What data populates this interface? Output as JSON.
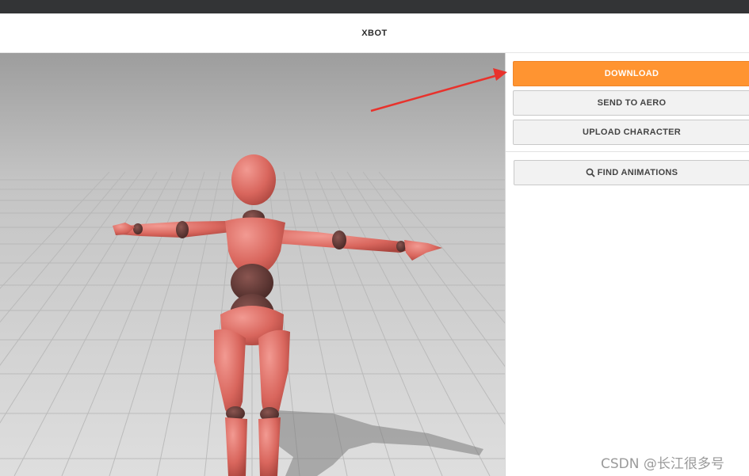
{
  "header": {
    "title": "XBOT"
  },
  "panel": {
    "download_label": "DOWNLOAD",
    "send_label": "SEND TO AERO",
    "upload_label": "UPLOAD CHARACTER",
    "find_label": "FIND ANIMATIONS"
  },
  "viewport": {
    "character_icon": "mannequin-model"
  },
  "annotation": {
    "arrow_color": "#e8322c"
  },
  "watermark": {
    "text": "CSDN @长江很多号"
  },
  "colors": {
    "accent": "#ff9431",
    "topbar": "#333436"
  }
}
